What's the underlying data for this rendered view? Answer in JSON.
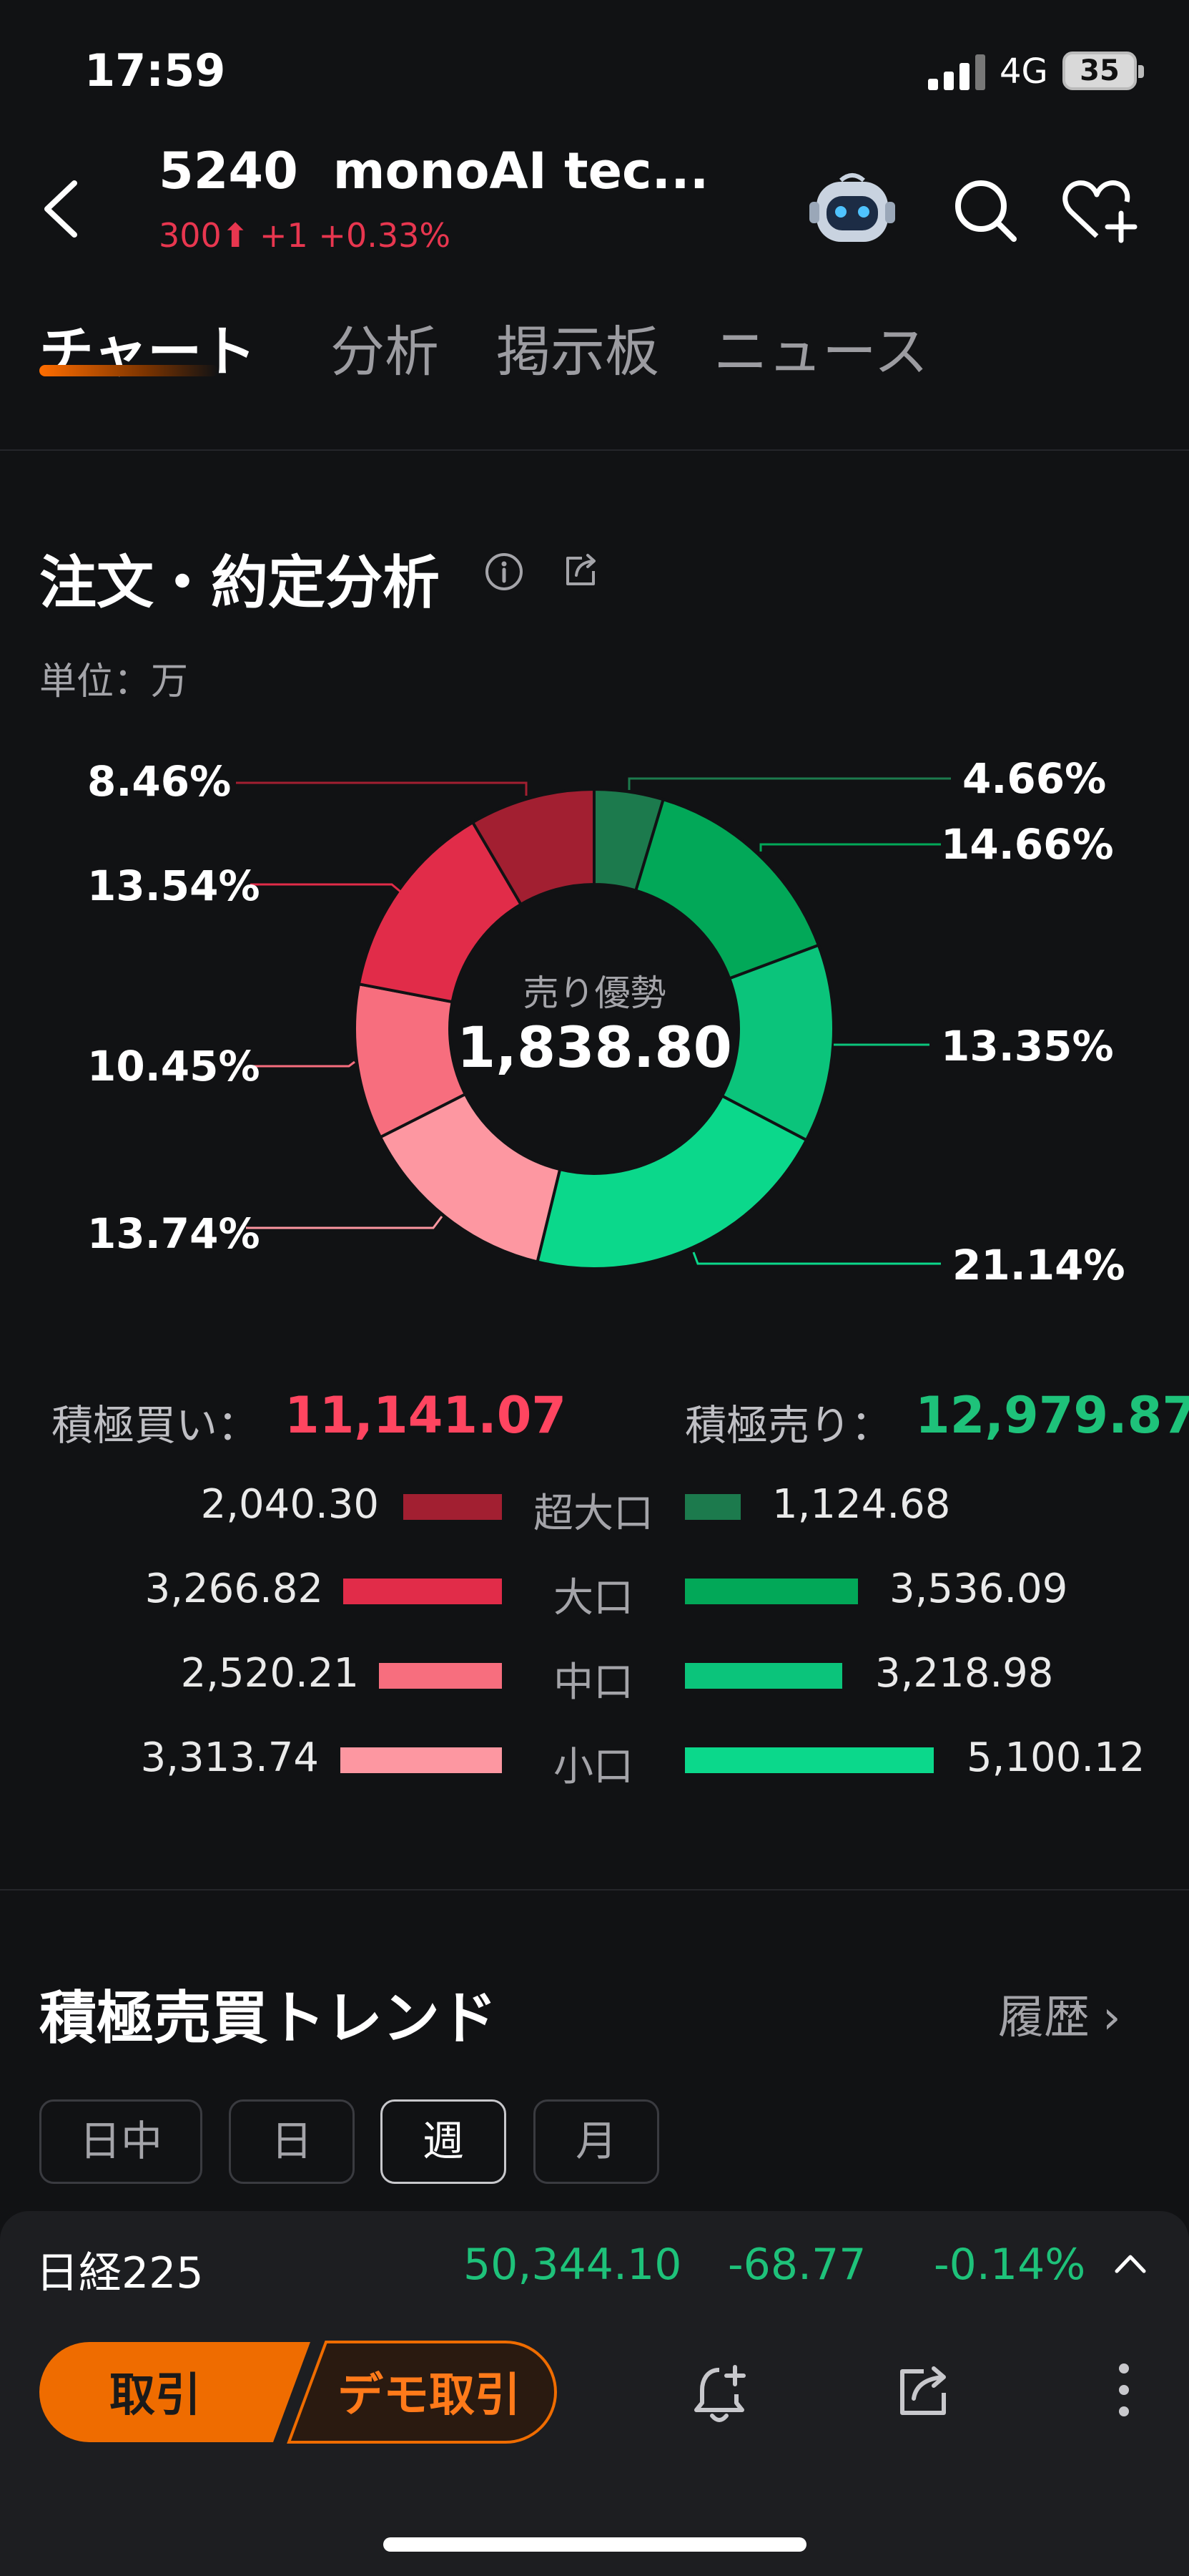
{
  "status_bar": {
    "time": "17:59",
    "network": "4G",
    "battery": "35"
  },
  "header": {
    "code": "5240",
    "name": "monoAI tec...",
    "price": "300",
    "change": "+1",
    "change_pct": "+0.33%"
  },
  "tabs": [
    "チャート",
    "分析",
    "掲示板",
    "ニュース"
  ],
  "analysis": {
    "title": "注文・約定分析",
    "unit": "単位：万",
    "center_label": "売り優勢",
    "center_value": "1,838.80",
    "buy_label": "積極買い：",
    "buy_total": "11,141.07",
    "sell_label": "積極売り：",
    "sell_total": "12,979.87",
    "rows": [
      {
        "category": "超大口",
        "buy": "2,040.30",
        "sell": "1,124.68"
      },
      {
        "category": "大口",
        "buy": "3,266.82",
        "sell": "3,536.09"
      },
      {
        "category": "中口",
        "buy": "2,520.21",
        "sell": "3,218.98"
      },
      {
        "category": "小口",
        "buy": "3,313.74",
        "sell": "5,100.12"
      }
    ]
  },
  "chart_data": {
    "type": "pie",
    "donut": true,
    "title": "",
    "center_text": [
      "売り優勢",
      "1,838.80"
    ],
    "slices": [
      {
        "group": "sell",
        "category": "超大口",
        "pct": 4.66,
        "value": 1124.68,
        "color": "#1c7a4d"
      },
      {
        "group": "sell",
        "category": "大口",
        "pct": 14.66,
        "value": 3536.09,
        "color": "#02a858"
      },
      {
        "group": "sell",
        "category": "中口",
        "pct": 13.35,
        "value": 3218.98,
        "color": "#0bc47b"
      },
      {
        "group": "sell",
        "category": "小口",
        "pct": 21.14,
        "value": 5100.12,
        "color": "#0bd88b"
      },
      {
        "group": "buy",
        "category": "小口",
        "pct": 13.74,
        "value": 3313.74,
        "color": "#fd97a1"
      },
      {
        "group": "buy",
        "category": "中口",
        "pct": 10.45,
        "value": 2520.21,
        "color": "#f76e7e"
      },
      {
        "group": "buy",
        "category": "大口",
        "pct": 13.54,
        "value": 3266.82,
        "color": "#e12c49"
      },
      {
        "group": "buy",
        "category": "超大口",
        "pct": 8.46,
        "value": 2040.3,
        "color": "#a21f31"
      }
    ],
    "labels": [
      "4.66%",
      "14.66%",
      "13.35%",
      "21.14%",
      "13.74%",
      "10.45%",
      "13.54%",
      "8.46%"
    ]
  },
  "trend": {
    "title": "積極売買トレンド",
    "history": "履歴",
    "periods": [
      "日中",
      "日",
      "週",
      "月"
    ],
    "active_period": "週"
  },
  "ticker": {
    "name": "日経225",
    "price": "50,344.10",
    "change": "-68.77",
    "change_pct": "-0.14%"
  },
  "actions": {
    "trade": "取引",
    "demo": "デモ取引"
  },
  "colors": {
    "up": "#e8364f",
    "down": "#1ec27a",
    "accent": "#ff6d00",
    "background": "#111214"
  }
}
